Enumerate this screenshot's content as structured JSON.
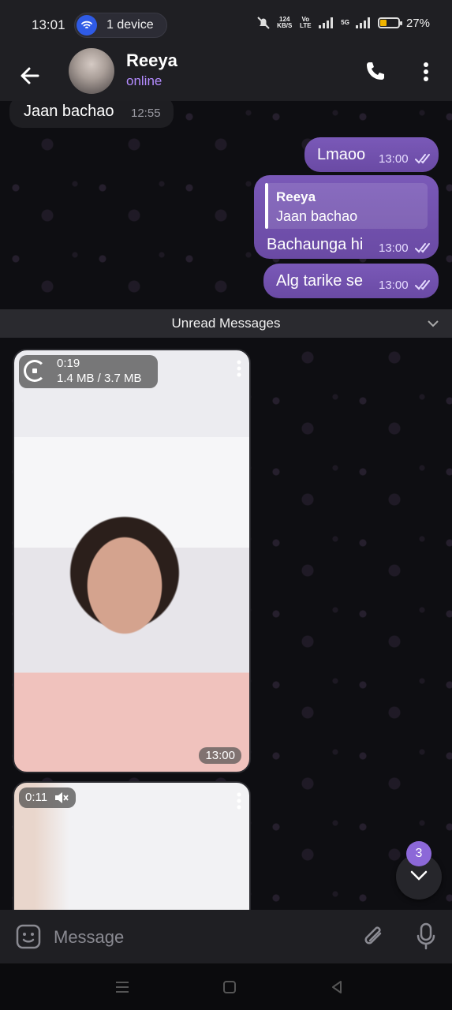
{
  "status_bar": {
    "time": "13:01",
    "device_pill": "1 device",
    "net_speed_value": "124",
    "net_speed_unit": "KB/S",
    "volte": "Vo LTE",
    "network": "5G",
    "battery": "27%"
  },
  "header": {
    "contact_name": "Reeya",
    "contact_status": "online"
  },
  "messages": {
    "m1": {
      "text": "Jaan bachao",
      "time": "12:55"
    },
    "m2": {
      "text": "Lmaoo",
      "time": "13:00"
    },
    "m3": {
      "reply_name": "Reeya",
      "reply_text": "Jaan bachao",
      "text": "Bachaunga hi",
      "time": "13:00"
    },
    "m4": {
      "text": "Alg tarike se",
      "time": "13:00"
    }
  },
  "unread_divider": "Unread Messages",
  "videos": [
    {
      "duration": "0:19",
      "size": "1.4 MB / 3.7 MB",
      "time": "13:00"
    },
    {
      "duration": "0:11"
    }
  ],
  "scroll_badge": "3",
  "composer": {
    "placeholder": "Message"
  },
  "colors": {
    "accent": "#8c68d8",
    "online": "#b48cff",
    "outgoing_bubble": "#6f4fae"
  },
  "icons": [
    "back-arrow-icon",
    "phone-icon",
    "more-vert-icon",
    "double-check-icon",
    "chevron-down-icon",
    "emoji-icon",
    "attach-icon",
    "mic-icon",
    "mute-icon"
  ]
}
